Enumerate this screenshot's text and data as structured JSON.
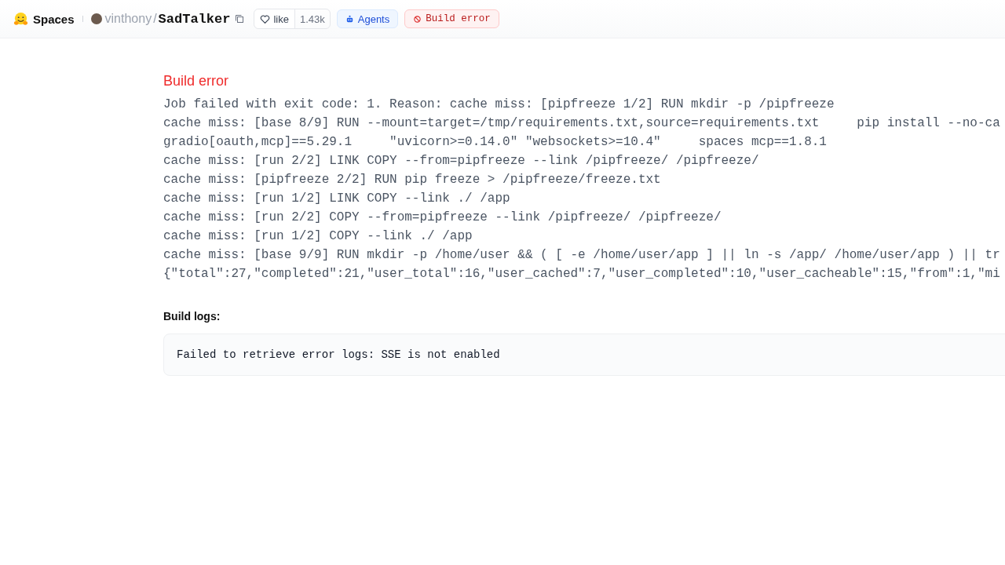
{
  "header": {
    "brand": "Spaces",
    "owner": "vinthony",
    "separator": "/",
    "repo": "SadTalker",
    "like": {
      "label": "like",
      "count": "1.43k"
    },
    "tags": [
      {
        "kind": "agents",
        "label": "Agents"
      },
      {
        "kind": "error",
        "label": "Build error"
      }
    ]
  },
  "error": {
    "title": "Build error",
    "lines": [
      "Job failed with exit code: 1. Reason: cache miss: [pipfreeze 1/2] RUN mkdir -p /pipfreeze",
      "cache miss: [base 8/9] RUN --mount=target=/tmp/requirements.txt,source=requirements.txt     pip install --no-ca",
      "gradio[oauth,mcp]==5.29.1     \"uvicorn>=0.14.0\" \"websockets>=10.4\"     spaces mcp==1.8.1",
      "cache miss: [run 2/2] LINK COPY --from=pipfreeze --link /pipfreeze/ /pipfreeze/",
      "cache miss: [pipfreeze 2/2] RUN pip freeze > /pipfreeze/freeze.txt",
      "cache miss: [run 1/2] LINK COPY --link ./ /app",
      "cache miss: [run 2/2] COPY --from=pipfreeze --link /pipfreeze/ /pipfreeze/",
      "cache miss: [run 1/2] COPY --link ./ /app",
      "cache miss: [base 9/9] RUN mkdir -p /home/user && ( [ -e /home/user/app ] || ln -s /app/ /home/user/app ) || tr",
      "{\"total\":27,\"completed\":21,\"user_total\":16,\"user_cached\":7,\"user_completed\":10,\"user_cacheable\":15,\"from\":1,\"mi"
    ]
  },
  "logs": {
    "title": "Build logs:",
    "message": "Failed to retrieve error logs: SSE is not enabled"
  }
}
